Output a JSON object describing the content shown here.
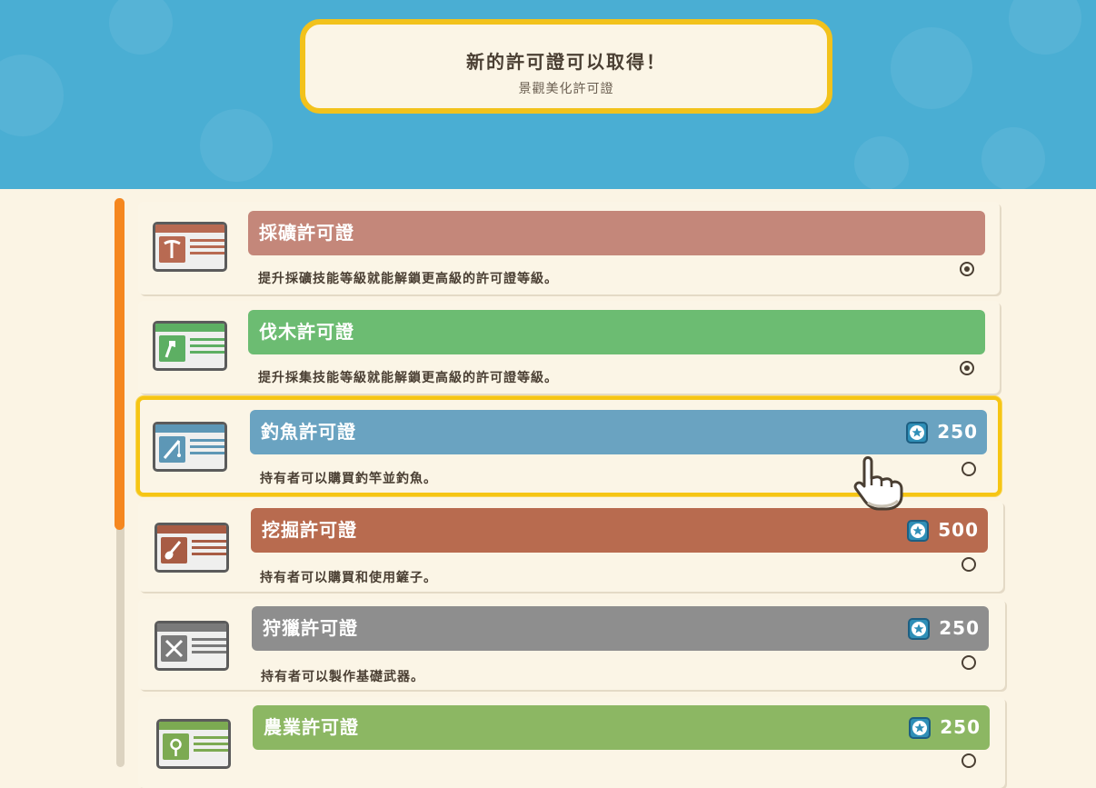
{
  "banner": {
    "title": "新的許可證可以取得！",
    "subtitle": "景觀美化許可證"
  },
  "colors": {
    "sky": "#4aaed3",
    "panel": "#fbf4e4",
    "highlight": "#f6c514",
    "scroll_thumb": "#f5871f"
  },
  "licenses": [
    {
      "name": "採礦許可證",
      "description": "提升採礦技能等級就能解鎖更高級的許可證等級。",
      "price": "",
      "bar_color": "#c4877a",
      "icon": "pickaxe-icon",
      "state": "owned"
    },
    {
      "name": "伐木許可證",
      "description": "提升採集技能等級就能解鎖更高級的許可證等級。",
      "price": "",
      "bar_color": "#6cbc72",
      "icon": "axe-icon",
      "state": "owned"
    },
    {
      "name": "釣魚許可證",
      "description": "持有者可以購買釣竿並釣魚。",
      "price": "250",
      "bar_color": "#6aa3c1",
      "icon": "fishing-rod-icon",
      "state": "available",
      "selected": true
    },
    {
      "name": "挖掘許可證",
      "description": "持有者可以購買和使用鏟子。",
      "price": "500",
      "bar_color": "#b86b4f",
      "icon": "shovel-icon",
      "state": "available"
    },
    {
      "name": "狩獵許可證",
      "description": "持有者可以製作基礎武器。",
      "price": "250",
      "bar_color": "#8e8e8e",
      "icon": "crossed-weapons-icon",
      "state": "available"
    },
    {
      "name": "農業許可證",
      "description": "",
      "price": "250",
      "bar_color": "#8cb763",
      "icon": "sprout-icon",
      "state": "available"
    }
  ]
}
